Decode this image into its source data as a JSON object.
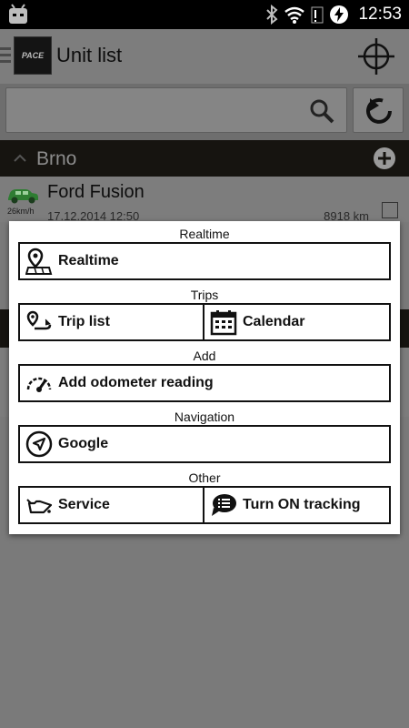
{
  "status_bar": {
    "time": "12:53",
    "icons": [
      "android-icon",
      "bluetooth-icon",
      "wifi-icon",
      "signal-icon",
      "battery-charging-icon"
    ]
  },
  "app_bar": {
    "logo_text": "PACE",
    "title": "Unit list",
    "icons": [
      "menu-icon",
      "crosshair-icon"
    ]
  },
  "search": {
    "value": "",
    "icons": [
      "search-icon",
      "refresh-icon"
    ]
  },
  "group": {
    "name": "Brno",
    "icons": [
      "chevron-up-icon",
      "add-icon"
    ]
  },
  "unit": {
    "name": "Ford Fusion",
    "speed": "26km/h",
    "date": "17.12.2014 12:50",
    "odometer": "8918 km",
    "checked": false,
    "car_color": "#2e7d32"
  },
  "dialog": {
    "sections": {
      "realtime": {
        "title": "Realtime",
        "buttons": {
          "realtime": "Realtime"
        }
      },
      "trips": {
        "title": "Trips",
        "buttons": {
          "trip_list": "Trip list",
          "calendar": "Calendar"
        }
      },
      "add": {
        "title": "Add",
        "buttons": {
          "odometer": "Add odometer reading"
        }
      },
      "navigation": {
        "title": "Navigation",
        "buttons": {
          "google": "Google"
        }
      },
      "other": {
        "title": "Other",
        "buttons": {
          "service": "Service",
          "tracking": "Turn ON tracking"
        }
      }
    }
  }
}
